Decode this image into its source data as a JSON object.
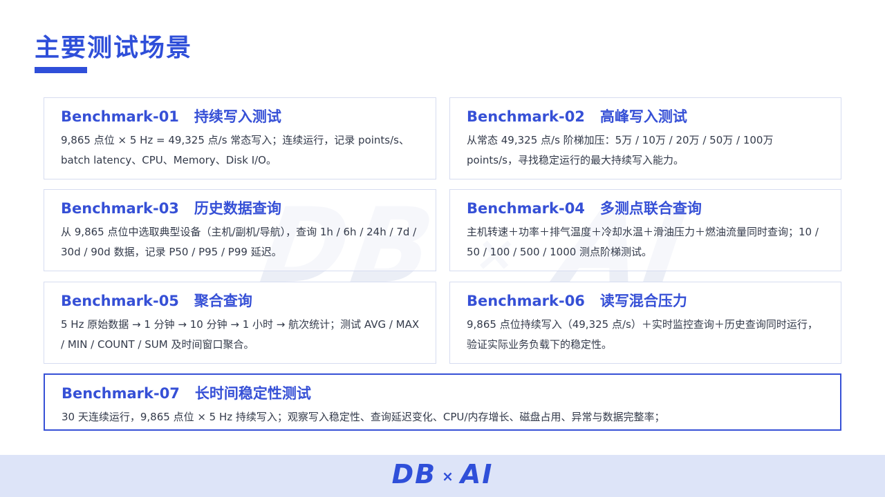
{
  "page": {
    "title": "主要测试场景"
  },
  "watermark": {
    "left": "DB",
    "sep": "×",
    "right": "AI"
  },
  "cards": [
    {
      "id": "Benchmark-01",
      "title": "持续写入测试",
      "desc": "9,865 点位 × 5 Hz = 49,325 点/s 常态写入；连续运行，记录 points/s、batch latency、CPU、Memory、Disk I/O。"
    },
    {
      "id": "Benchmark-02",
      "title": "高峰写入测试",
      "desc": "从常态 49,325 点/s 阶梯加压：5万 / 10万 / 20万 / 50万 / 100万 points/s，寻找稳定运行的最大持续写入能力。"
    },
    {
      "id": "Benchmark-03",
      "title": "历史数据查询",
      "desc": "从 9,865 点位中选取典型设备（主机/副机/导航），查询 1h / 6h / 24h / 7d / 30d / 90d 数据，记录 P50 / P95 / P99 延迟。"
    },
    {
      "id": "Benchmark-04",
      "title": "多测点联合查询",
      "desc": "主机转速＋功率＋排气温度＋冷却水温＋滑油压力＋燃油流量同时查询；10 / 50 / 100 / 500 / 1000 测点阶梯测试。"
    },
    {
      "id": "Benchmark-05",
      "title": "聚合查询",
      "desc": "5 Hz 原始数据 → 1 分钟 → 10 分钟 → 1 小时 → 航次统计；测试 AVG / MAX / MIN / COUNT / SUM 及时间窗口聚合。"
    },
    {
      "id": "Benchmark-06",
      "title": "读写混合压力",
      "desc": "9,865 点位持续写入（49,325 点/s）＋实时监控查询＋历史查询同时运行，验证实际业务负载下的稳定性。"
    },
    {
      "id": "Benchmark-07",
      "title": "长时间稳定性测试",
      "desc": "30 天连续运行，9,865 点位 × 5 Hz 持续写入；观察写入稳定性、查询延迟变化、CPU/内存增长、磁盘占用、异常与数据完整率；"
    }
  ],
  "footer": {
    "logo_left": "DB",
    "logo_sep": "×",
    "logo_right": "AI"
  }
}
